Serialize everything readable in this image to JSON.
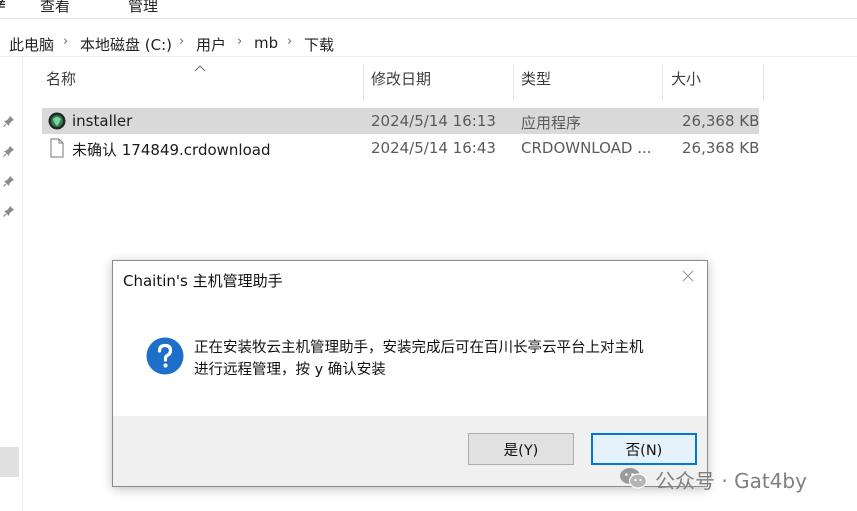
{
  "ribbon": {
    "items": [
      "查看",
      "管理"
    ]
  },
  "address": {
    "crumbs": [
      "此电脑",
      "本地磁盘 (C:)",
      "用户",
      "mb",
      "下载"
    ]
  },
  "columns": {
    "name": "名称",
    "modified": "修改日期",
    "type": "类型",
    "size": "大小"
  },
  "files": [
    {
      "name": "installer",
      "modified": "2024/5/14 16:13",
      "type": "应用程序",
      "size": "26,368 KB",
      "icon": "app-installer-icon",
      "selected": true
    },
    {
      "name": "未确认 174849.crdownload",
      "modified": "2024/5/14 16:43",
      "type": "CRDOWNLOAD ...",
      "size": "26,368 KB",
      "icon": "file-icon",
      "selected": false
    }
  ],
  "dialog": {
    "title": "Chaitin's 主机管理助手",
    "message_line1": "正在安装牧云主机管理助手，安装完成后可在百川长亭云平台上对主机",
    "message_line2": "进行远程管理，按 y 确认安装",
    "yes_label": "是(Y)",
    "no_label": "否(N)",
    "icon": "question-icon"
  },
  "watermark": {
    "text": "公众号 · Gat4by"
  },
  "colors": {
    "selection": "#d9d9d9",
    "accent": "#0078d7",
    "question": "#1e6fc9"
  }
}
